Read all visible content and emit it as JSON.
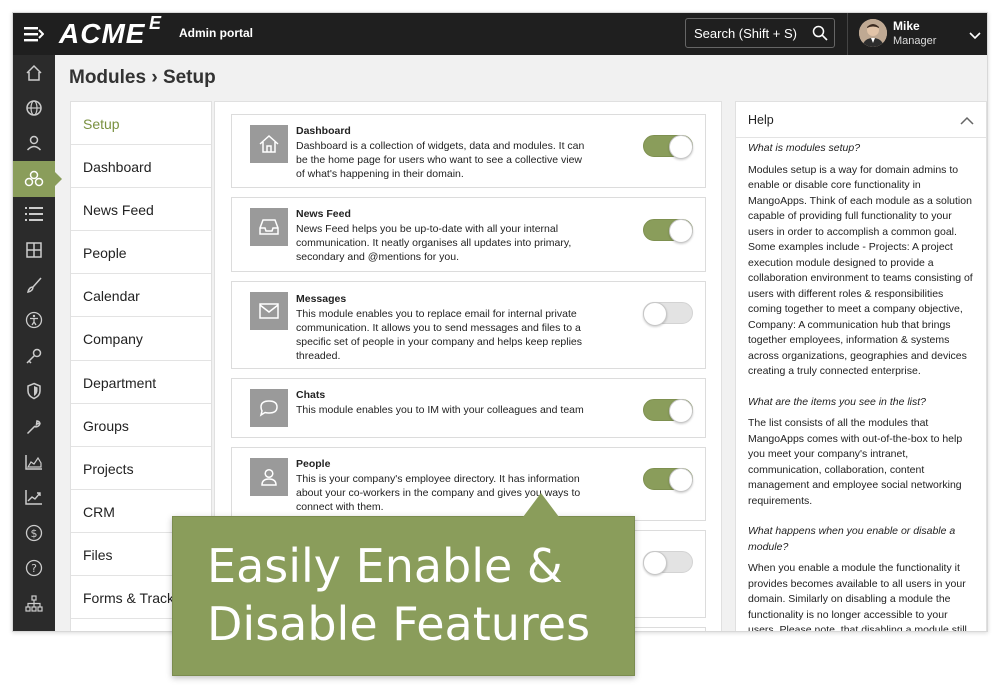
{
  "header": {
    "logo": "ACME",
    "logo_mark": "E",
    "portal_label": "Admin portal",
    "search_label": "Search (Shift + S)",
    "user_name": "Mike",
    "user_role": "Manager"
  },
  "rail": {
    "icons": [
      "home-icon",
      "globe-icon",
      "user-icon",
      "modules-icon",
      "list-icon",
      "grid-icon",
      "brush-icon",
      "accessibility-icon",
      "key-icon",
      "shield-icon",
      "wrench-icon",
      "area-chart-icon",
      "trend-chart-icon",
      "dollar-icon",
      "help-icon",
      "org-chart-icon"
    ],
    "active_index": 3
  },
  "page": {
    "title": "Modules › Setup"
  },
  "subnav": {
    "items": [
      "Setup",
      "Dashboard",
      "News Feed",
      "People",
      "Calendar",
      "Company",
      "Department",
      "Groups",
      "Projects",
      "CRM",
      "Files",
      "Forms & Track"
    ],
    "active_index": 0
  },
  "modules": [
    {
      "title": "Dashboard",
      "desc": "Dashboard is a collection of widgets, data and modules. It can be the home page for users who want to see a collective view of what's happening in their domain.",
      "enabled": true,
      "icon": "home-icon"
    },
    {
      "title": "News Feed",
      "desc": "News Feed helps you be up-to-date with all your internal communication. It neatly organises all updates into primary, secondary and @mentions for you.",
      "enabled": true,
      "icon": "inbox-icon"
    },
    {
      "title": "Messages",
      "desc": "This module enables you to replace email for internal private communication. It allows you to send messages and files to a specific set of people in your company and helps keep replies threaded.",
      "enabled": false,
      "icon": "envelope-icon"
    },
    {
      "title": "Chats",
      "desc": "This module enables you to IM with your colleagues and team",
      "enabled": true,
      "icon": "chat-icon"
    },
    {
      "title": "People",
      "desc": "This is your company's employee directory. It has information about your co-workers in the company and gives you ways to connect with them.",
      "enabled": true,
      "icon": "person-icon"
    },
    {
      "title": "",
      "desc": "",
      "enabled": false,
      "icon": ""
    }
  ],
  "help": {
    "title": "Help",
    "sections": [
      {
        "q": "What is modules setup?",
        "a": "Modules setup is a way for domain admins to enable or disable core functionality in MangoApps. Think of each module as a solution capable of providing full functionality to your users in order to accomplish a common goal. Some examples include - Projects: A project execution module designed to provide a collaboration environment to teams consisting of users with different roles & responsibilities coming together to meet a company objective, Company: A communication hub that brings together employees, information & systems across organizations, geographies and devices creating a truly connected enterprise."
      },
      {
        "q": "What are the items you see in the list?",
        "a": "The list consists of all the modules that MangoApps comes with out-of-the-box to help you meet your company's intranet, communication, collaboration, content management and employee social networking requirements."
      },
      {
        "q": "What happens when you enable or disable a module?",
        "a": "When you enable a module the functionality it provides becomes available to all users in your domain. Similarly on disabling a module the functionality is no longer accessible to your users. Please note, that disabling a module still"
      }
    ]
  },
  "callout": {
    "line1": "Easily Enable &",
    "line2": "Disable Features"
  },
  "colors": {
    "accent": "#8a9d5b",
    "topbar": "#1f1f1f",
    "rail": "#2b2b2b"
  }
}
